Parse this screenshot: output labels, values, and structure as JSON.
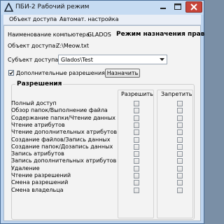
{
  "window": {
    "title": "ПБИ-2 Рабочий режим",
    "icons": {
      "app": "triangle-app-icon",
      "minimize": "minimize-icon",
      "maximize": "maximize-icon",
      "close": "close-icon"
    },
    "colors": {
      "frame": "#bcd3ee",
      "close_button": "#c7453a",
      "client": "#f3f3f3"
    }
  },
  "menu": {
    "items": [
      "Объект доступа",
      "Автомат. настройка"
    ]
  },
  "info": {
    "computer_label": "Наименование компьютера:",
    "computer_value": "GLADOS",
    "mode": "Режим назначения прав",
    "object_label": "Объект доступа:",
    "object_value": "Z:\\Meow.txt"
  },
  "subject": {
    "label": "Субъект доступа",
    "selected": "Glados\\Test"
  },
  "extra_permissions": {
    "label": "Дополнительные разрешения",
    "checked": true
  },
  "assign_button": {
    "label": "Назначить"
  },
  "permissions": {
    "title": "Разрешения",
    "allow_header": "Разрешить",
    "deny_header": "Запретить",
    "rows": [
      {
        "name": "Полный доступ",
        "allow": false,
        "deny": false
      },
      {
        "name": "Обзор папок/Выполнение файла",
        "allow": false,
        "deny": false
      },
      {
        "name": "Содержание папки/Чтение данных",
        "allow": false,
        "deny": false
      },
      {
        "name": "Чтение атрибутов",
        "allow": false,
        "deny": false
      },
      {
        "name": "Чтение дополнительных атрибутов",
        "allow": false,
        "deny": false
      },
      {
        "name": "Создание файлов/Запись данных",
        "allow": false,
        "deny": false
      },
      {
        "name": "Создание папок/Дозапись данных",
        "allow": false,
        "deny": false
      },
      {
        "name": "Запись атрибутов",
        "allow": false,
        "deny": false
      },
      {
        "name": "Запись дополнительных атрибутов",
        "allow": false,
        "deny": false
      },
      {
        "name": "Удаление",
        "allow": false,
        "deny": false
      },
      {
        "name": "Чтение разрешений",
        "allow": false,
        "deny": false
      },
      {
        "name": "Смена разрешений",
        "allow": false,
        "deny": false
      },
      {
        "name": "Смена владельца",
        "allow": false,
        "deny": false
      }
    ]
  }
}
